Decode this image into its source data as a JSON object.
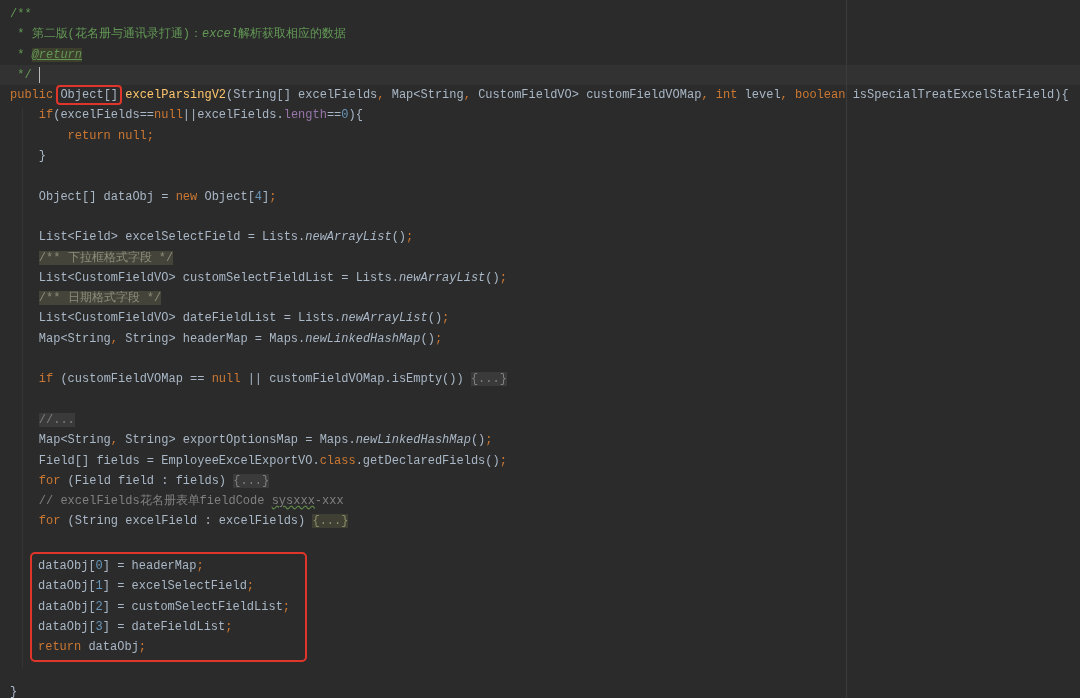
{
  "editor": {
    "blocks": [
      {
        "boxed": false,
        "lines": [
          {
            "kind": "code",
            "current": false,
            "tokens": [
              {
                "kind": "doc",
                "text": "/**"
              }
            ]
          },
          {
            "kind": "code",
            "current": false,
            "tokens": [
              {
                "kind": "doc",
                "text": " * 第二版(花名册与通讯录打通)："
              },
              {
                "kind": "doc_italic",
                "text": "excel"
              },
              {
                "kind": "doc",
                "text": "解析获取相应的数据"
              }
            ]
          },
          {
            "kind": "code",
            "current": false,
            "tokens": [
              {
                "kind": "doc",
                "text": " * "
              },
              {
                "kind": "doc_tag",
                "text": "@return"
              }
            ]
          },
          {
            "kind": "code",
            "current": true,
            "tokens": [
              {
                "kind": "doc",
                "text": " */"
              }
            ]
          },
          {
            "kind": "code",
            "current": false,
            "tokens": [
              {
                "kind": "keyword",
                "text": "public "
              },
              {
                "kind": "marked",
                "text": "Object[]"
              },
              {
                "kind": "declaration",
                "text": " excelParsingV2"
              },
              {
                "kind": "plain",
                "text": "(String[] excelFields"
              },
              {
                "kind": "punct",
                "text": ", "
              },
              {
                "kind": "plain",
                "text": "Map<String"
              },
              {
                "kind": "punct",
                "text": ", "
              },
              {
                "kind": "plain",
                "text": "CustomFieldVO> customFieldVOMap"
              },
              {
                "kind": "punct",
                "text": ", "
              },
              {
                "kind": "keyword",
                "text": "int"
              },
              {
                "kind": "plain",
                "text": " level"
              },
              {
                "kind": "punct",
                "text": ", "
              },
              {
                "kind": "keyword",
                "text": "boolean"
              },
              {
                "kind": "plain",
                "text": " isSpecialTreatExcelStatField){"
              }
            ]
          },
          {
            "kind": "code",
            "current": false,
            "tokens": [
              {
                "kind": "keyword",
                "text": "    if"
              },
              {
                "kind": "plain",
                "text": "(excelFields=="
              },
              {
                "kind": "keyword",
                "text": "null"
              },
              {
                "kind": "plain",
                "text": "||excelFields."
              },
              {
                "kind": "field",
                "text": "length"
              },
              {
                "kind": "plain",
                "text": "=="
              },
              {
                "kind": "number",
                "text": "0"
              },
              {
                "kind": "plain",
                "text": "){"
              }
            ]
          },
          {
            "kind": "code",
            "current": false,
            "tokens": [
              {
                "kind": "keyword",
                "text": "        return null"
              },
              {
                "kind": "punct",
                "text": ";"
              }
            ]
          },
          {
            "kind": "code",
            "current": false,
            "tokens": [
              {
                "kind": "plain",
                "text": "    }"
              }
            ]
          },
          {
            "kind": "blank"
          },
          {
            "kind": "code",
            "current": false,
            "tokens": [
              {
                "kind": "plain",
                "text": "    Object[] dataObj = "
              },
              {
                "kind": "keyword",
                "text": "new"
              },
              {
                "kind": "plain",
                "text": " Object["
              },
              {
                "kind": "number",
                "text": "4"
              },
              {
                "kind": "plain",
                "text": "]"
              },
              {
                "kind": "punct",
                "text": ";"
              }
            ]
          },
          {
            "kind": "blank"
          },
          {
            "kind": "code",
            "current": false,
            "tokens": [
              {
                "kind": "plain",
                "text": "    List<Field> excelSelectField = Lists."
              },
              {
                "kind": "static_call",
                "text": "newArrayList"
              },
              {
                "kind": "plain",
                "text": "()"
              },
              {
                "kind": "punct",
                "text": ";"
              }
            ]
          },
          {
            "kind": "code",
            "current": false,
            "tokens": [
              {
                "kind": "block_comment",
                "text": "    /** 下拉框格式字段 */"
              }
            ]
          },
          {
            "kind": "code",
            "current": false,
            "tokens": [
              {
                "kind": "plain",
                "text": "    List<CustomFieldVO> customSelectFieldList = Lists."
              },
              {
                "kind": "static_call",
                "text": "newArrayList"
              },
              {
                "kind": "plain",
                "text": "()"
              },
              {
                "kind": "punct",
                "text": ";"
              }
            ]
          },
          {
            "kind": "code",
            "current": false,
            "tokens": [
              {
                "kind": "block_comment",
                "text": "    /** 日期格式字段 */"
              }
            ]
          },
          {
            "kind": "code",
            "current": false,
            "tokens": [
              {
                "kind": "plain",
                "text": "    List<CustomFieldVO> dateFieldList = Lists."
              },
              {
                "kind": "static_call",
                "text": "newArrayList"
              },
              {
                "kind": "plain",
                "text": "()"
              },
              {
                "kind": "punct",
                "text": ";"
              }
            ]
          },
          {
            "kind": "code",
            "current": false,
            "tokens": [
              {
                "kind": "plain",
                "text": "    Map<String"
              },
              {
                "kind": "punct",
                "text": ", "
              },
              {
                "kind": "plain",
                "text": "String> headerMap = Maps."
              },
              {
                "kind": "static_call",
                "text": "newLinkedHashMap"
              },
              {
                "kind": "plain",
                "text": "()"
              },
              {
                "kind": "punct",
                "text": ";"
              }
            ]
          },
          {
            "kind": "blank"
          },
          {
            "kind": "code",
            "current": false,
            "tokens": [
              {
                "kind": "keyword",
                "text": "    if"
              },
              {
                "kind": "plain",
                "text": " (customFieldVOMap == "
              },
              {
                "kind": "keyword",
                "text": "null"
              },
              {
                "kind": "plain",
                "text": " || customFieldVOMap.isEmpty()) "
              },
              {
                "kind": "fold",
                "text": "{...}"
              }
            ]
          },
          {
            "kind": "blank"
          },
          {
            "kind": "code",
            "current": false,
            "tokens": [
              {
                "kind": "fold",
                "text": "    //..."
              }
            ]
          },
          {
            "kind": "code",
            "current": false,
            "tokens": [
              {
                "kind": "plain",
                "text": "    Map<String"
              },
              {
                "kind": "punct",
                "text": ", "
              },
              {
                "kind": "plain",
                "text": "String> exportOptionsMap = Maps."
              },
              {
                "kind": "static_call",
                "text": "newLinkedHashMap"
              },
              {
                "kind": "plain",
                "text": "()"
              },
              {
                "kind": "punct",
                "text": ";"
              }
            ]
          },
          {
            "kind": "code",
            "current": false,
            "tokens": [
              {
                "kind": "plain",
                "text": "    Field[] fields = EmployeeExcelExportVO."
              },
              {
                "kind": "keyword",
                "text": "class"
              },
              {
                "kind": "plain",
                "text": ".getDeclaredFields()"
              },
              {
                "kind": "punct",
                "text": ";"
              }
            ]
          },
          {
            "kind": "code",
            "current": false,
            "tokens": [
              {
                "kind": "keyword",
                "text": "    for"
              },
              {
                "kind": "plain",
                "text": " (Field field : fields) "
              },
              {
                "kind": "fold",
                "text": "{...}"
              }
            ]
          },
          {
            "kind": "code",
            "current": false,
            "tokens": [
              {
                "kind": "comment",
                "text": "    // excelFields花名册表单fieldCode "
              },
              {
                "kind": "typo",
                "text": "sysxxx"
              },
              {
                "kind": "comment",
                "text": "-xxx"
              }
            ]
          },
          {
            "kind": "code",
            "current": false,
            "tokens": [
              {
                "kind": "keyword",
                "text": "    for"
              },
              {
                "kind": "plain",
                "text": " (String excelField : excelFields) "
              },
              {
                "kind": "fold_highlighted",
                "text": "{...}"
              }
            ]
          },
          {
            "kind": "blank"
          }
        ]
      },
      {
        "boxed": true,
        "lines": [
          {
            "kind": "code",
            "current": false,
            "tokens": [
              {
                "kind": "plain",
                "text": "dataObj["
              },
              {
                "kind": "number",
                "text": "0"
              },
              {
                "kind": "plain",
                "text": "] = headerMap"
              },
              {
                "kind": "punct",
                "text": ";"
              }
            ]
          },
          {
            "kind": "code",
            "current": false,
            "tokens": [
              {
                "kind": "plain",
                "text": "dataObj["
              },
              {
                "kind": "number",
                "text": "1"
              },
              {
                "kind": "plain",
                "text": "] = excelSelectField"
              },
              {
                "kind": "punct",
                "text": ";"
              }
            ]
          },
          {
            "kind": "code",
            "current": false,
            "tokens": [
              {
                "kind": "plain",
                "text": "dataObj["
              },
              {
                "kind": "number",
                "text": "2"
              },
              {
                "kind": "plain",
                "text": "] = customSelectFieldList"
              },
              {
                "kind": "punct",
                "text": ";"
              }
            ]
          },
          {
            "kind": "code",
            "current": false,
            "tokens": [
              {
                "kind": "plain",
                "text": "dataObj["
              },
              {
                "kind": "number",
                "text": "3"
              },
              {
                "kind": "plain",
                "text": "] = dateFieldList"
              },
              {
                "kind": "punct",
                "text": ";"
              }
            ]
          },
          {
            "kind": "code",
            "current": false,
            "tokens": [
              {
                "kind": "keyword",
                "text": "return "
              },
              {
                "kind": "plain",
                "text": "dataObj"
              },
              {
                "kind": "punct",
                "text": ";"
              }
            ]
          }
        ]
      },
      {
        "boxed": false,
        "lines": [
          {
            "kind": "blank"
          },
          {
            "kind": "code",
            "current": false,
            "tokens": [
              {
                "kind": "plain",
                "text": "}"
              }
            ]
          }
        ]
      }
    ]
  }
}
